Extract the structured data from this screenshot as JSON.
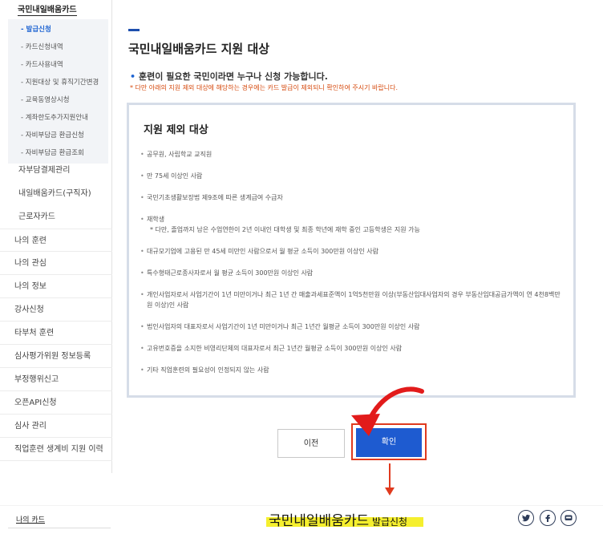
{
  "sidebar": {
    "top_label": "국민내일배움카드",
    "sub_items": [
      {
        "label": "발급신청",
        "active": true
      },
      {
        "label": "카드신청내역"
      },
      {
        "label": "카드사용내역"
      },
      {
        "label": "지원대상 및 휴직기간변경"
      },
      {
        "label": "교육동영상시청"
      },
      {
        "label": "계좌한도추가지원안내"
      },
      {
        "label": "자비부담금 환급신청"
      },
      {
        "label": "자비부담금 환급조회"
      }
    ],
    "groups": [
      "자부담결제관리",
      "내일배움카드(구직자)",
      "근로자카드"
    ],
    "main_items": [
      "나의 훈련",
      "나의 관심",
      "나의 정보",
      "강사신청",
      "타부처 훈련",
      "심사평가위원 정보등록",
      "부정행위신고",
      "오픈API신청",
      "심사 관리",
      "직업훈련 생계비 지원 이력"
    ]
  },
  "main": {
    "title": "국민내일배움카드 지원 대상",
    "subtitle_bullet": "•",
    "subtitle": "훈련이 필요한 국민이라면 누구나 신청 가능합니다.",
    "notice": "* 다만 아래의 지원 제외 대상에 해당하는 경우에는 카드 발급이 제외되니 확인하여 주시기 바랍니다.",
    "box_title": "지원 제외 대상",
    "exclusions": [
      {
        "text": "공무원, 사립학교 교직원"
      },
      {
        "text": "만 75세 이상인 사람"
      },
      {
        "text": "국민기초생활보장법 제9조에 따른 생계급여 수급자"
      },
      {
        "text": "재학생",
        "sub": "* 다만, 졸업까지 남은 수업연한이 2년 이내인 대학생 및 최종 학년에 재학 중인 고등학생은 지원 가능"
      },
      {
        "text": "대규모기업에 고용된 만 45세 미만인 사람으로서 월 평균 소득이 300만원 이상인 사람"
      },
      {
        "text": "특수형태근로종사자로서 월 평균 소득이 300만원 이상인 사람"
      },
      {
        "text": "개인사업자로서 사업기간이 1년 미만이거나 최근 1년 간 매출과세표준액이 1억5천만원 이상(부동산임대사업자의 경우 부동산임대공급가액이 연 4천8백만원 이상)인 사람"
      },
      {
        "text": "법인사업자의 대표자로서 사업기간이 1년 미만이거나 최근 1년간 월평균 소득이 300만원 이상인 사람"
      },
      {
        "text": "고유번호증을 소지한 비영리단체의 대표자로서 최근 1년간 월평균 소득이 300만원 이상인 사람"
      },
      {
        "text": "기타 직업훈련의 필요성이 인정되지 않는 사람"
      }
    ],
    "prev_label": "이전",
    "confirm_label": "확인"
  },
  "footer": {
    "my_card": "나의 카드",
    "brand": "국민내일배움카드",
    "brand_suffix": " 발급신청"
  },
  "colors": {
    "accent": "#1e5bd0",
    "annotation": "#e03a1e",
    "highlight": "#f5ef2e",
    "notice": "#d64a0e"
  },
  "icons": [
    "twitter-icon",
    "facebook-icon",
    "chat-icon"
  ]
}
